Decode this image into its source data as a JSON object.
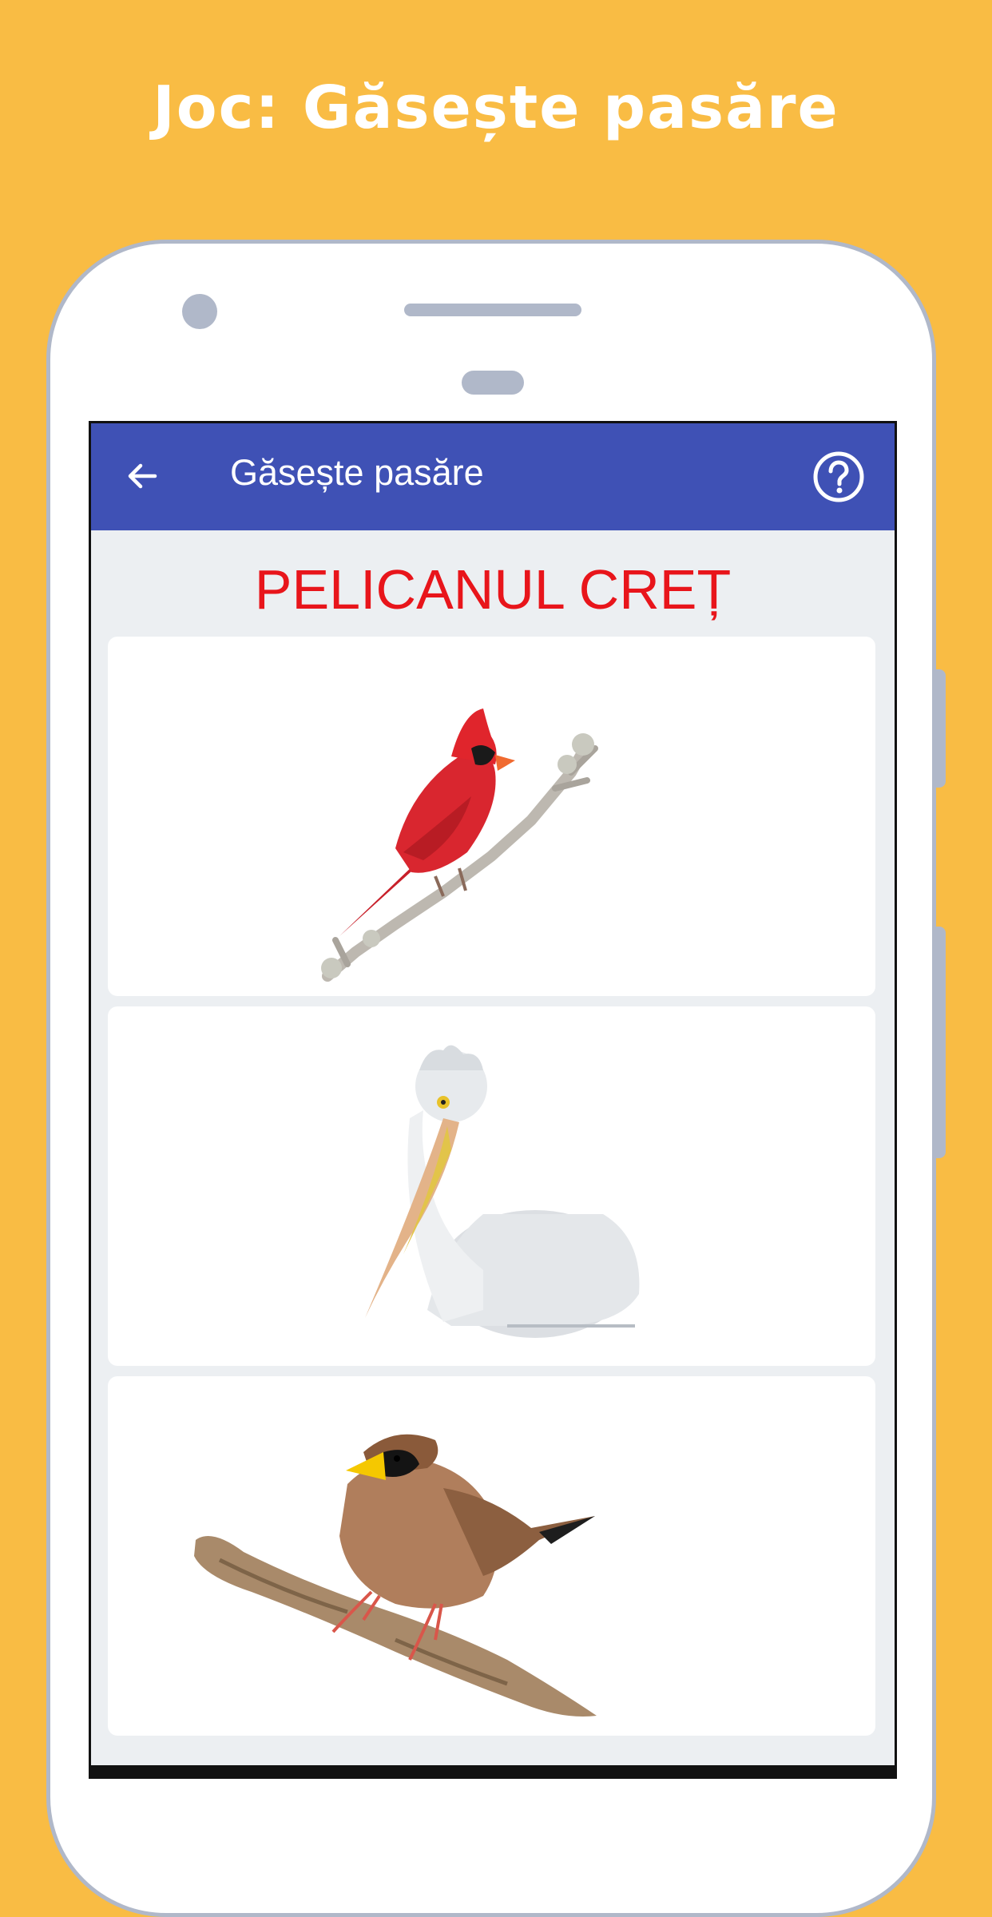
{
  "promo": {
    "title": "Joc: Găsește pasăre"
  },
  "appbar": {
    "title": "Găsește pasăre",
    "back_icon": "arrow-left-icon",
    "help_icon": "help-circle-icon",
    "color": "#3F51B5"
  },
  "question": {
    "text": "PELICANUL CREȚ",
    "color": "#E8151B"
  },
  "options": [
    {
      "image": "cardinal-bird"
    },
    {
      "image": "pelican-bird"
    },
    {
      "image": "finch-bird"
    }
  ],
  "colors": {
    "background": "#F9BC44",
    "screen": "#ECEFF2",
    "phone_frame": "#B0B8C9"
  }
}
